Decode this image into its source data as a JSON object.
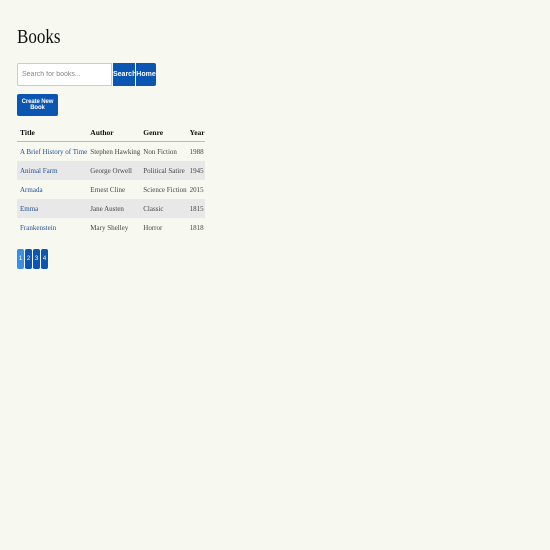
{
  "page": {
    "title": "Books"
  },
  "search": {
    "placeholder": "Search for books...",
    "button_label": "Search",
    "home_label": "Home"
  },
  "actions": {
    "create_label": "Create New Book"
  },
  "table": {
    "headers": [
      "Title",
      "Author",
      "Genre",
      "Year"
    ],
    "rows": [
      [
        "A Brief History of Time",
        "Stephen Hawking",
        "Non Fiction",
        "1988"
      ],
      [
        "Animal Farm",
        "George Orwell",
        "Political Satire",
        "1945"
      ],
      [
        "Armada",
        "Ernest Cline",
        "Science Fiction",
        "2015"
      ],
      [
        "Emma",
        "Jane Austen",
        "Classic",
        "1815"
      ],
      [
        "Frankenstein",
        "Mary Shelley",
        "Horror",
        "1818"
      ]
    ]
  },
  "pagination": {
    "pages": [
      "1",
      "2",
      "3",
      "4"
    ],
    "current": "1"
  },
  "colors": {
    "background": "#f7f8f0",
    "primary": "#0b56b3",
    "active_page": "#3a8fe0",
    "link": "#1f4f94",
    "row_shade": "#e8e8e8"
  }
}
